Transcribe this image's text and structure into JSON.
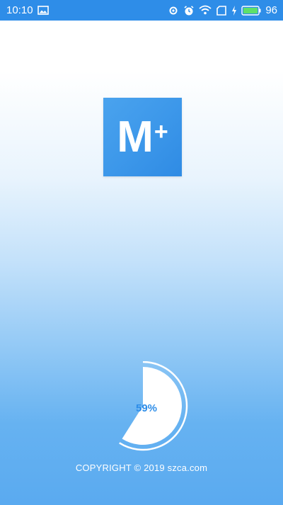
{
  "status_bar": {
    "time": "10:10",
    "battery_level": "96",
    "icons": [
      "image-icon",
      "sync-icon",
      "alarm-icon",
      "wifi-icon",
      "sim-icon",
      "charging-icon",
      "battery-icon"
    ]
  },
  "logo": {
    "letter": "M",
    "plus": "+"
  },
  "loading": {
    "percent_label": "59%",
    "progress_fraction": 0.59
  },
  "footer": {
    "copyright": "COPYRIGHT © 2019 szca.com"
  },
  "colors": {
    "accent": "#2e8de8",
    "status_bar": "#2e8de8",
    "logo": "#3d98ea"
  }
}
